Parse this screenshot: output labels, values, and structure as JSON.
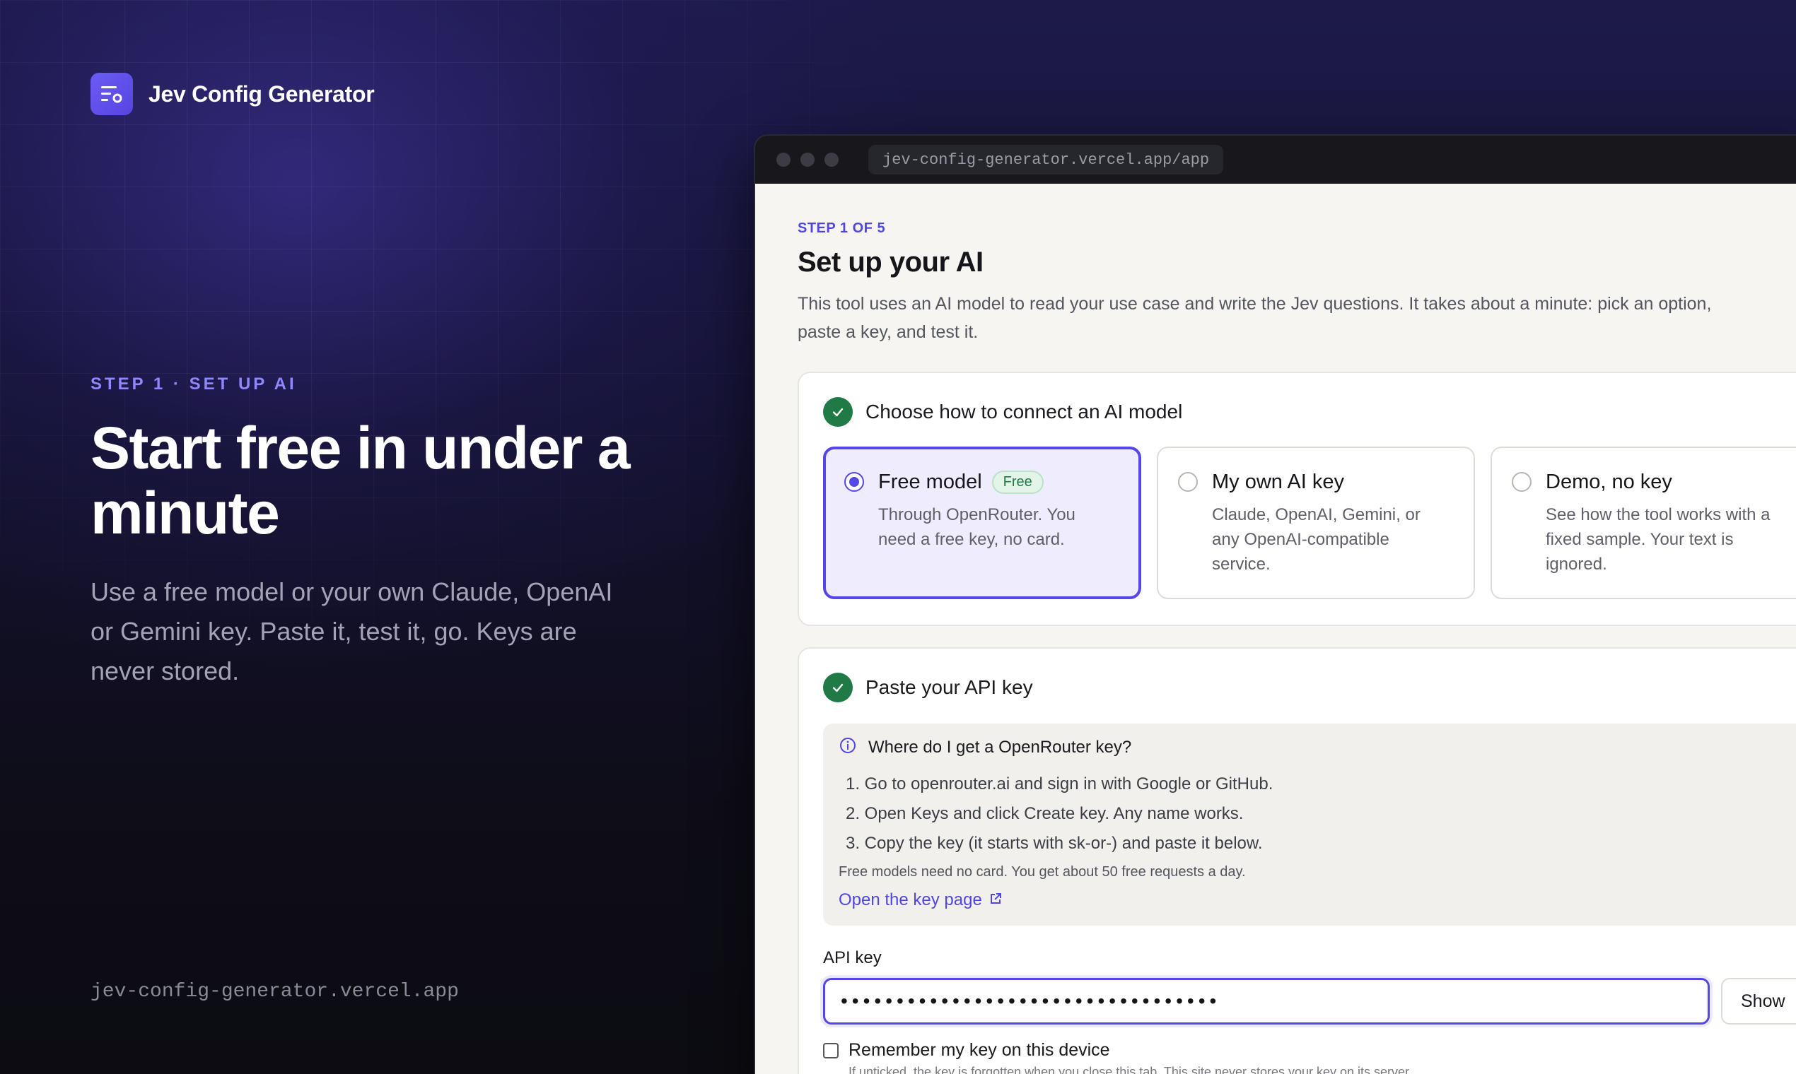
{
  "brand": {
    "name": "Jev Config Generator",
    "logo_icon": "filter-list-icon"
  },
  "hero": {
    "eyebrow": "STEP 1 · SET UP AI",
    "title": "Start free in under a minute",
    "subtitle": "Use a free model or your own Claude, OpenAI or Gemini key. Paste it, test it, go. Keys are never stored.",
    "footer_url": "jev-config-generator.vercel.app"
  },
  "browser": {
    "url": "jev-config-generator.vercel.app/app"
  },
  "page": {
    "step_label": "STEP 1 OF 5",
    "title": "Set up your AI",
    "description": "This tool uses an AI model to read your use case and write the Jev questions. It takes about a minute: pick an option, paste a key, and test it."
  },
  "connect_card": {
    "title": "Choose how to connect an AI model",
    "options": [
      {
        "title": "Free model",
        "badge": "Free",
        "description": "Through OpenRouter. You need a free key, no card.",
        "selected": true
      },
      {
        "title": "My own AI key",
        "badge": "",
        "description": "Claude, OpenAI, Gemini, or any OpenAI-compatible service.",
        "selected": false
      },
      {
        "title": "Demo, no key",
        "badge": "",
        "description": "See how the tool works with a fixed sample. Your text is ignored.",
        "selected": false
      }
    ]
  },
  "key_card": {
    "title": "Paste your API key",
    "help": {
      "title": "Where do I get a OpenRouter key?",
      "steps": [
        "1. Go to openrouter.ai and sign in with Google or GitHub.",
        "2. Open Keys and click Create key. Any name works.",
        "3. Copy the key (it starts with sk-or-) and paste it below."
      ],
      "note": "Free models need no card. You get about 50 free requests a day.",
      "link": "Open the key page"
    },
    "field_label": "API key",
    "key_value": "••••••••••••••••••••••••••••••••••",
    "show_label": "Show",
    "remember_label": "Remember my key on this device",
    "remember_note": "If unticked, the key is forgotten when you close this tab. This site never stores your key on its server."
  },
  "colors": {
    "accent": "#5546e8",
    "success": "#1f7a45",
    "page_bg": "#f6f5f2"
  }
}
